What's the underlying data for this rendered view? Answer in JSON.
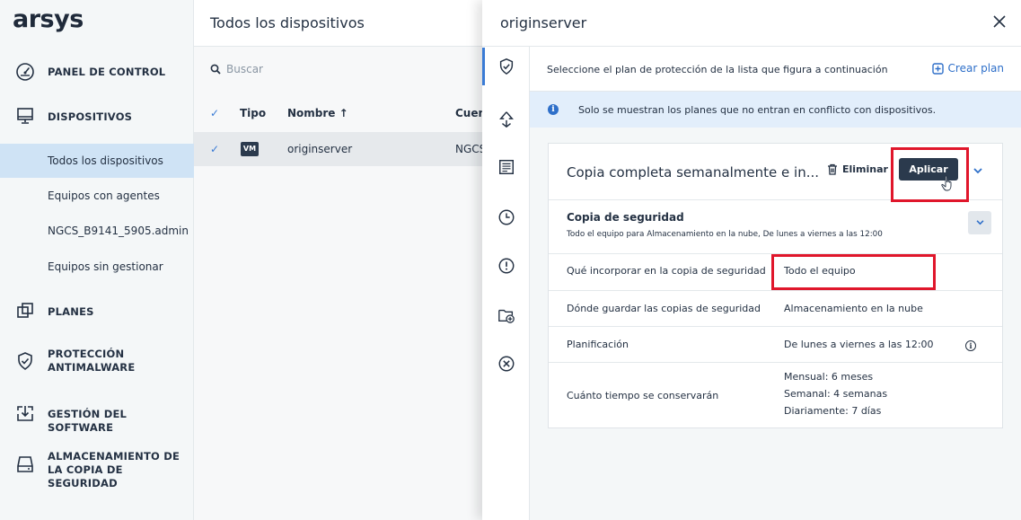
{
  "brand": {
    "logo": "arsys"
  },
  "sidebar": {
    "items": [
      {
        "label": "PANEL DE CONTROL",
        "icon": "dashboard-gauge-icon"
      },
      {
        "label": "DISPOSITIVOS",
        "icon": "monitor-icon"
      },
      {
        "label": "PLANES",
        "icon": "plans-icon"
      },
      {
        "label": "PROTECCIÓN\nANTIMALWARE",
        "label_line1": "PROTECCIÓN",
        "label_line2": "ANTIMALWARE",
        "icon": "shield-check-icon"
      },
      {
        "label": "GESTIÓN DEL SOFTWARE",
        "icon": "software-update-icon"
      },
      {
        "label_line1": "ALMACENAMIENTO DE",
        "label_line2": "LA COPIA DE SEGURIDAD",
        "icon": "storage-drive-icon"
      }
    ],
    "subitems": [
      {
        "label": "Todos los dispositivos",
        "active": true
      },
      {
        "label": "Equipos con agentes"
      },
      {
        "label": "NGCS_B9141_5905.admin"
      },
      {
        "label": "Equipos sin gestionar"
      }
    ]
  },
  "list": {
    "title": "Todos los dispositivos",
    "search_placeholder": "Buscar",
    "columns": {
      "type": "Tipo",
      "name": "Nombre ↑",
      "account": "Cuen"
    },
    "rows": [
      {
        "type_badge": "VM",
        "name": "originserver",
        "account": "NGCS"
      }
    ]
  },
  "drawer": {
    "title": "originserver",
    "instruction": "Seleccione el plan de protección de la lista que figura a continuación",
    "create_plan": "Crear plan",
    "info": "Solo se muestran los planes que no entran en conflicto con dispositivos.",
    "rail_icons": [
      "shield-check-icon",
      "recovery-icon",
      "document-list-icon",
      "clock-icon",
      "alert-icon",
      "folder-add-icon",
      "cancel-circle-icon"
    ],
    "plan": {
      "title": "Copia completa semanalmente e in...",
      "delete_label": "Eliminar",
      "apply_label": "Aplicar",
      "section_title": "Copia de seguridad",
      "section_subtitle": "Todo el equipo para Almacenamiento en la nube, De lunes a viernes a las 12:00",
      "properties": [
        {
          "label": "Qué incorporar en la copia de seguridad",
          "value": "Todo el equipo"
        },
        {
          "label": "Dónde guardar las copias de seguridad",
          "value": "Almacenamiento en la nube"
        },
        {
          "label": "Planificación",
          "value": "De lunes a viernes a las 12:00"
        },
        {
          "label": "Cuánto tiempo se conservarán",
          "values": [
            "Mensual: 6 meses",
            "Semanal: 4 semanas",
            "Diariamente: 7 días"
          ]
        }
      ]
    }
  },
  "colors": {
    "accent": "#2e6fc9",
    "highlight": "#e0162b",
    "dark_button": "#2b3a4d",
    "active_nav": "#cfe3f5"
  }
}
